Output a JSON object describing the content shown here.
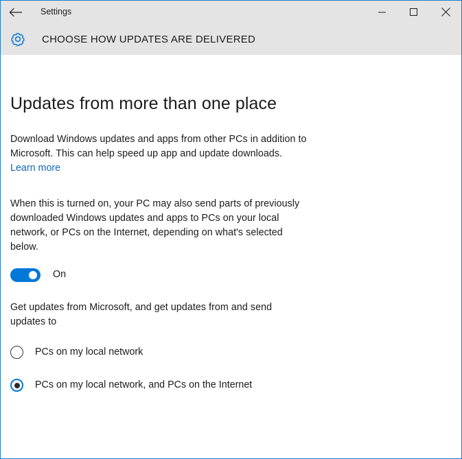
{
  "window": {
    "border_color": "#1a7ecd",
    "titlebar_bg": "#e4e4e4",
    "accent_color": "#0078d7"
  },
  "titlebar": {
    "back_label": "back-arrow",
    "app_title": "Settings",
    "minimize_label": "Minimize",
    "maximize_label": "Maximize",
    "close_label": "Close"
  },
  "page_header": {
    "icon": "gear-icon",
    "title": "CHOOSE HOW UPDATES ARE DELIVERED"
  },
  "main": {
    "heading": "Updates from more than one place",
    "intro_paragraph": "Download Windows updates and apps from other PCs in addition to Microsoft. This can help speed up app and update downloads.",
    "learn_more_link": "Learn more",
    "detail_paragraph": "When this is turned on, your PC may also send parts of previously downloaded Windows updates and apps to PCs on your local network, or PCs on the Internet, depending on what's selected below.",
    "toggle": {
      "state_label": "On",
      "checked": true
    },
    "radio_prompt": "Get updates from Microsoft, and get updates from and send updates to",
    "radio_options": [
      {
        "label": "PCs on my local network",
        "selected": false
      },
      {
        "label": "PCs on my local network, and PCs on the Internet",
        "selected": true
      }
    ]
  }
}
